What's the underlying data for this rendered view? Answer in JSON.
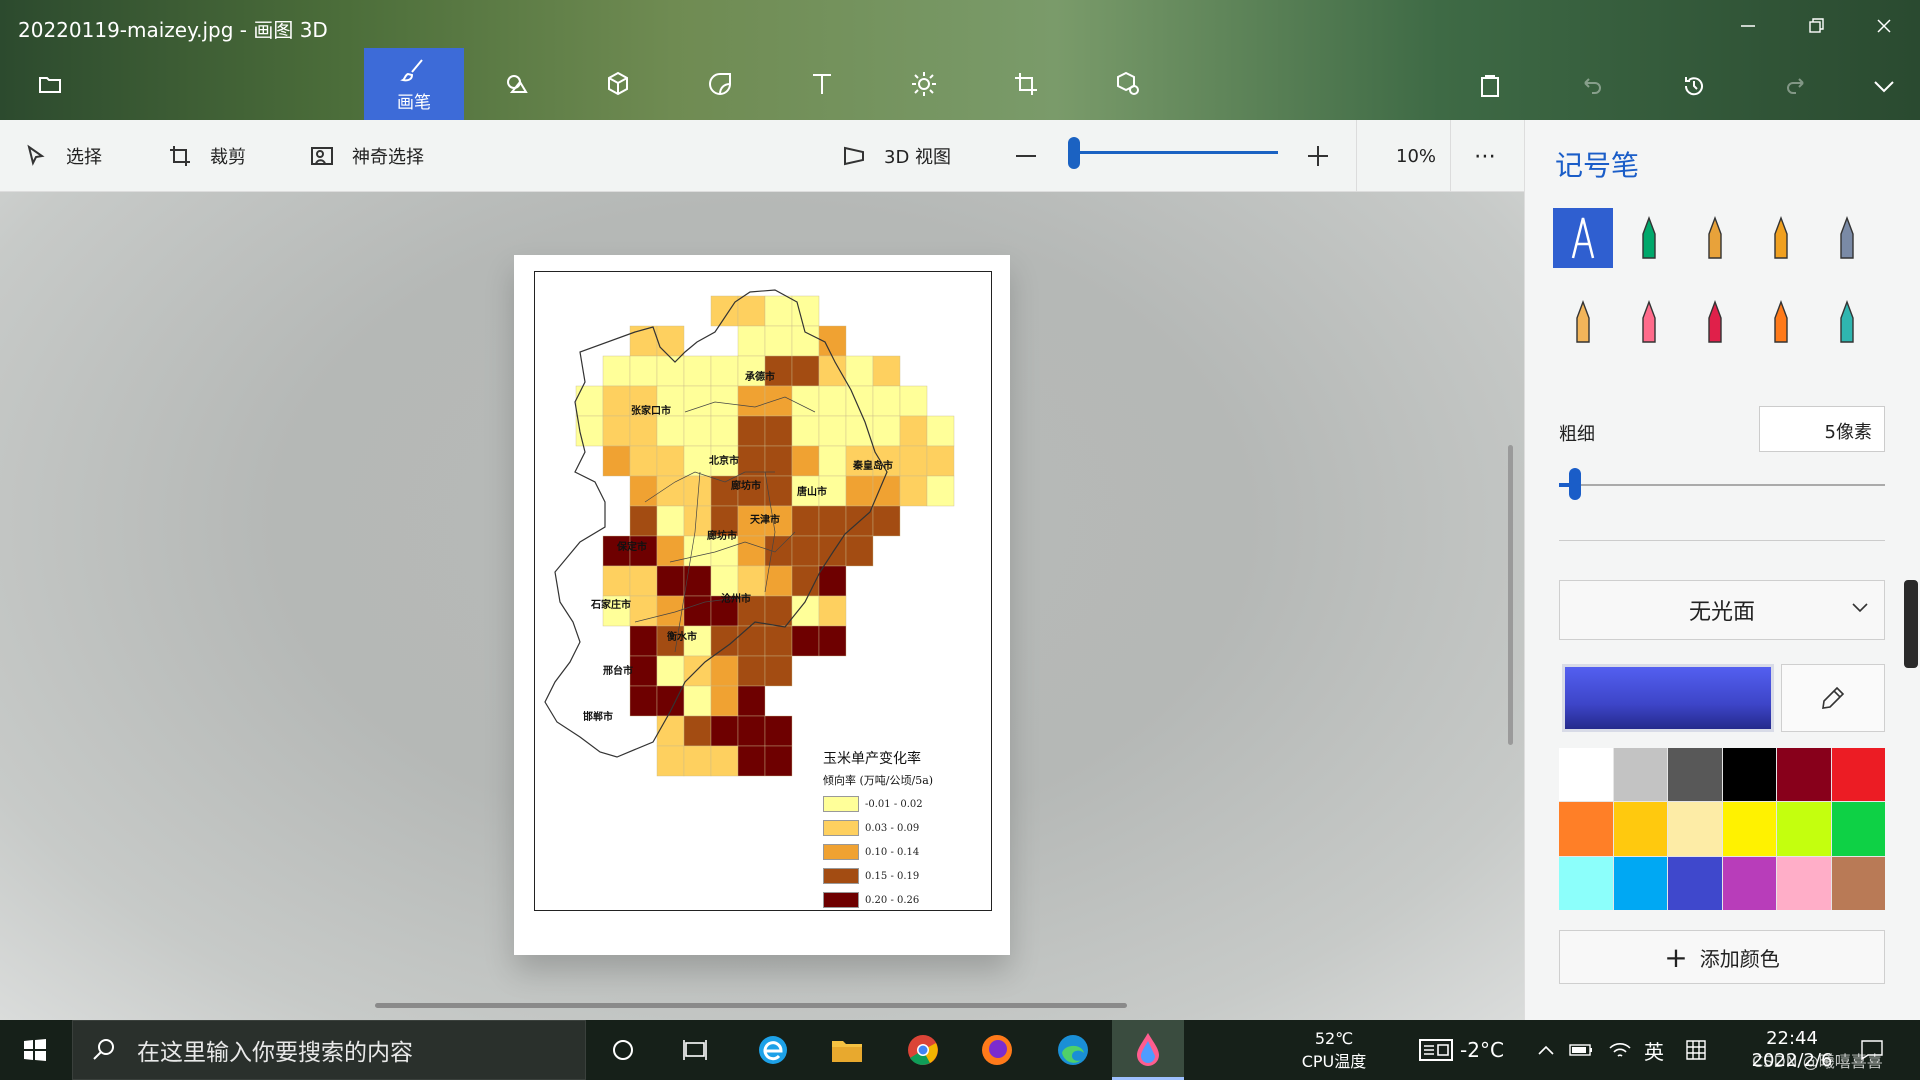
{
  "window": {
    "title": "20220119-maizey.jpg - 画图 3D"
  },
  "toolbar": {
    "brushes_label": "画笔",
    "active": "brushes"
  },
  "subbar": {
    "select": "选择",
    "crop": "裁剪",
    "magic_select": "神奇选择",
    "view3d": "3D 视图",
    "zoom": "10%",
    "zoom_fraction": 0.0
  },
  "panel": {
    "title": "记号笔",
    "size_label": "粗细",
    "size_value": "5像素",
    "size_fraction": 0.05,
    "finish": "无光面",
    "add_color": "添加颜色",
    "current_color": "#3d45c8",
    "palette": [
      "#ffffff",
      "#c3c3c3",
      "#585858",
      "#000000",
      "#88001b",
      "#ec1c24",
      "#ff7f27",
      "#ffc90e",
      "#fdeca6",
      "#fff200",
      "#c4ff0e",
      "#0ed145",
      "#8cfffb",
      "#00a8f3",
      "#3f48cc",
      "#b83dba",
      "#ffaec8",
      "#b97a56"
    ]
  },
  "map": {
    "cities": [
      "承德市",
      "张家口市",
      "北京市",
      "廊坊市",
      "唐山市",
      "秦皇岛市",
      "天津市",
      "保定市",
      "廊坊市",
      "沧州市",
      "石家庄市",
      "衡水市",
      "邢台市",
      "邯郸市"
    ],
    "legend": {
      "title": "玉米单产变化率",
      "subtitle": "倾向率 (万吨/公顷/5a)",
      "items": [
        {
          "label": "-0.01 - 0.02",
          "color": "#ffff99"
        },
        {
          "label": "0.03 - 0.09",
          "color": "#fed05f"
        },
        {
          "label": "0.10 - 0.14",
          "color": "#f0a232"
        },
        {
          "label": "0.15 - 0.19",
          "color": "#a34c12"
        },
        {
          "label": "0.20 - 0.26",
          "color": "#6e0000"
        }
      ]
    }
  },
  "taskbar": {
    "search_placeholder": "在这里输入你要搜索的内容",
    "cpu_temp": "52℃",
    "cpu_label": "CPU温度",
    "weather": "-2°C",
    "ime": "英",
    "time": "22:44",
    "date": "2022/2/6",
    "watermark": "CSDN @曦嘻喜喜"
  }
}
